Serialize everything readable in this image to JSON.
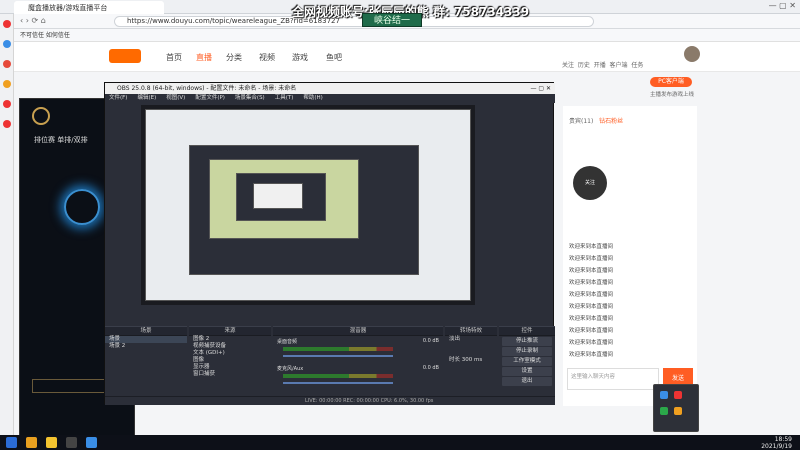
{
  "browser": {
    "tab_title": "魔盒播放器/游戏直播平台",
    "url": "https://www.douyu.com/topic/weareleague_ZB?rid=6183727",
    "bookmark": "不可信任 如何信任"
  },
  "watermark": {
    "line1": "全网视频账号:张辰辰的熊  群: 758734339",
    "line2": "峡谷结一"
  },
  "site": {
    "nav": [
      "首页",
      "直播",
      "分类",
      "视频",
      "游戏",
      "鱼吧"
    ],
    "top_icons": [
      "关注",
      "历史",
      "开播",
      "客户端",
      "任务"
    ],
    "pc_button": "PC客户端",
    "upload_hint": "主播发布游戏上线",
    "stream_label": "排位赛 单排/双排"
  },
  "obs": {
    "title": "OBS 25.0.8 (64-bit, windows) - 配置文件: 未命名 - 场景: 未命名",
    "menu": [
      "文件(F)",
      "编辑(E)",
      "视图(V)",
      "配置文件(P)",
      "场景集合(S)",
      "工具(T)",
      "帮助(H)"
    ],
    "docks": {
      "scenes": {
        "title": "场景",
        "items": [
          "场景",
          "场景 2"
        ]
      },
      "sources": {
        "title": "来源",
        "items": [
          "图像 2",
          "视频捕获设备",
          "文本 (GDI+)",
          "图像",
          "显示器",
          "窗口捕获"
        ]
      },
      "mixer": {
        "title": "混音器",
        "channels": [
          {
            "name": "桌面音频",
            "level": "0.0 dB"
          },
          {
            "name": "麦克风/Aux",
            "level": "0.0 dB"
          }
        ]
      },
      "transitions": {
        "title": "转场特效",
        "type": "淡出",
        "duration_label": "时长",
        "duration": "300 ms"
      },
      "controls": {
        "title": "控件",
        "buttons": [
          "停止推流",
          "停止录制",
          "工作室模式",
          "设置",
          "退出"
        ]
      }
    },
    "status": "LIVE: 00:00:00   REC: 00:00:00   CPU: 6.0%, 30.00 fps"
  },
  "chat": {
    "tabs": [
      "贵宾(11)",
      "钻石粉丝"
    ],
    "follow": "关注",
    "messages": [
      "欢迎来到本直播间",
      "欢迎来到本直播间",
      "欢迎来到本直播间",
      "欢迎来到本直播间",
      "欢迎来到本直播间",
      "欢迎来到本直播间",
      "欢迎来到本直播间",
      "欢迎来到本直播间",
      "欢迎来到本直播间",
      "欢迎来到本直播间"
    ],
    "input_placeholder": "这里输入聊天内容",
    "send": "发送"
  },
  "taskbar": {
    "time": "18:59",
    "date": "2021/9/19"
  }
}
